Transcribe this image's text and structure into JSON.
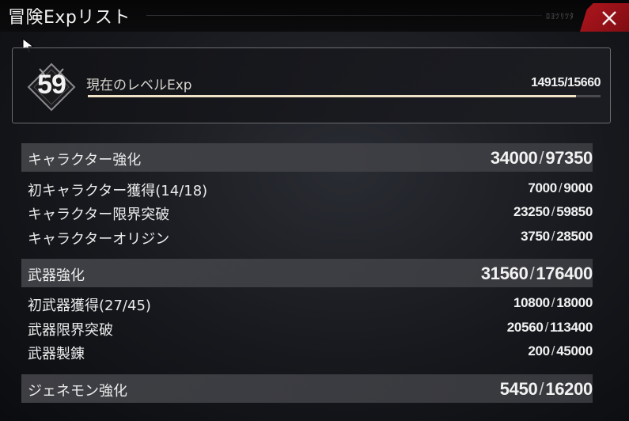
{
  "window": {
    "title": "冒険Expリスト",
    "deco_text": "ﾛﾖﾂﾘﾂﾀ"
  },
  "colors": {
    "accent": "#efe2c6",
    "close_bg": "#a8141b"
  },
  "level": {
    "number": "59",
    "label": "現在のレベルExp",
    "current": 14915,
    "max": 15660,
    "value_text": "14915/15660"
  },
  "sections": [
    {
      "title": "キャラクター強化",
      "current": "34000",
      "max": "97350",
      "items": [
        {
          "label": "初キャラクター獲得(14/18)",
          "current": "7000",
          "max": "9000"
        },
        {
          "label": "キャラクター限界突破",
          "current": "23250",
          "max": "59850"
        },
        {
          "label": "キャラクターオリジン",
          "current": "3750",
          "max": "28500"
        }
      ]
    },
    {
      "title": "武器強化",
      "current": "31560",
      "max": "176400",
      "items": [
        {
          "label": "初武器獲得(27/45)",
          "current": "10800",
          "max": "18000"
        },
        {
          "label": "武器限界突破",
          "current": "20560",
          "max": "113400"
        },
        {
          "label": "武器製錬",
          "current": "200",
          "max": "45000"
        }
      ]
    },
    {
      "title": "ジェネモン強化",
      "current": "5450",
      "max": "16200",
      "items": []
    }
  ]
}
